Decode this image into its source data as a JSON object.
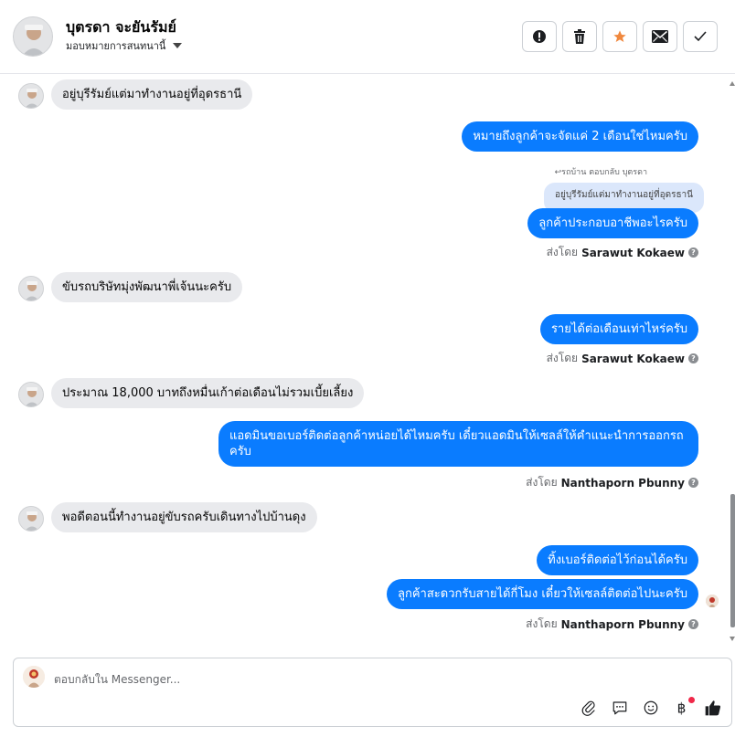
{
  "header": {
    "contact_name": "บุตรดา จะยันรัมย์",
    "assign_label": "มอบหมายการสนทนานี้",
    "actions": [
      {
        "name": "spam-icon"
      },
      {
        "name": "trash-icon"
      },
      {
        "name": "star-icon",
        "color": "#f0883e"
      },
      {
        "name": "mail-icon"
      },
      {
        "name": "check-icon"
      }
    ]
  },
  "messages": [
    {
      "dir": "in",
      "text": "อยู่บุรีรัมย์แต่มาทำงานอยู่ที่อุดรธานี"
    },
    {
      "dir": "out",
      "text": "หมายถึงลูกค้าจะจัดแค่ 2 เดือนใช่ไหมครับ"
    },
    {
      "dir": "out-reply",
      "reply_meta": "รถบ้าน ตอบกลับ บุตรดา",
      "quoted": "อยู่บุรีรัมย์แต่มาทำงานอยู่ที่อุดรธานี",
      "text": "ลูกค้าประกอบอาชีพอะไรครับ",
      "sent_by_prefix": "ส่งโดย",
      "sent_by": "Sarawut Kokaew"
    },
    {
      "dir": "in",
      "text": "ขับรถบริษัทมุ่งพัฒนาพี่เจ้นนะครับ"
    },
    {
      "dir": "out",
      "text": "รายได้ต่อเดือนเท่าไหร่ครับ",
      "sent_by_prefix": "ส่งโดย",
      "sent_by": "Sarawut Kokaew"
    },
    {
      "dir": "in",
      "text": "ประมาณ 18,000 บาทถึงหมื่นเก้าต่อเดือนไม่รวมเบี้ยเลี้ยง"
    },
    {
      "dir": "out",
      "text": "แอดมินขอเบอร์ติดต่อลูกค้าหน่อยได้ไหมครับ เดี๋ยวแอดมินให้เซลล์ให้คำแนะนำการออกรถครับ",
      "sent_by_prefix": "ส่งโดย",
      "sent_by": "Nanthaporn Pbunny"
    },
    {
      "dir": "in",
      "text": "พอดีตอนนี้ทำงานอยู่ขับรถครับเดินทางไปบ้านดุง"
    },
    {
      "dir": "out",
      "text": "ทิ้งเบอร์ติดต่อไว้ก่อนได้ครับ"
    },
    {
      "dir": "out",
      "text": "ลูกค้าสะดวกรับสายได้กี่โมง เดี๋ยวให้เซลล์ติดต่อไปนะครับ",
      "sent_by_prefix": "ส่งโดย",
      "sent_by": "Nanthaporn Pbunny"
    }
  ],
  "composer": {
    "placeholder": "ตอบกลับใน Messenger...",
    "tools": [
      "attach-icon",
      "saved-reply-icon",
      "emoji-icon",
      "payment-icon",
      "like-icon"
    ]
  },
  "colors": {
    "outgoing_bubble": "#0a7cff",
    "incoming_bubble": "#e9eaed",
    "accent": "#0a7cff"
  }
}
